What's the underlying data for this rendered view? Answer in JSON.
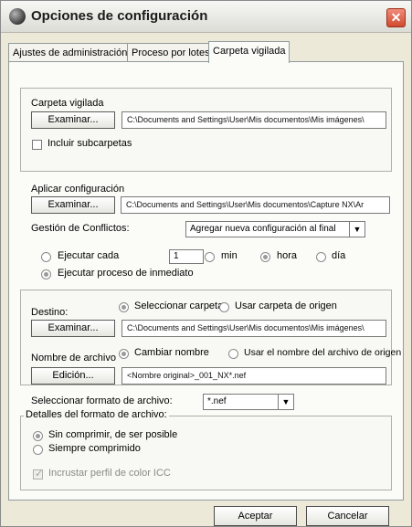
{
  "window": {
    "title": "Opciones de configuración"
  },
  "tabs": [
    "Ajustes de administración",
    "Proceso por lotes",
    "Carpeta vigilada"
  ],
  "watched": {
    "label": "Carpeta vigilada",
    "browse": "Examinar...",
    "path": "C:\\Documents and Settings\\User\\Mis documentos\\Mis imágenes\\",
    "subfolders": "Incluir subcarpetas"
  },
  "apply": {
    "label": "Aplicar configuración",
    "browse": "Examinar...",
    "path": "C:\\Documents and Settings\\User\\Mis documentos\\Capture NX\\Ar",
    "conflicts_label": "Gestión de Conflictos:",
    "conflicts_value": "Agregar nueva configuración al final",
    "run_every": "Ejecutar cada",
    "interval": "1",
    "unit_min": "min",
    "unit_hour": "hora",
    "unit_day": "día",
    "run_now": "Ejecutar proceso de inmediato"
  },
  "destination": {
    "label": "Destino:",
    "select_folder": "Seleccionar carpeta",
    "use_source": "Usar carpeta de origen",
    "browse": "Examinar...",
    "path": "C:\\Documents and Settings\\User\\Mis documentos\\Mis imágenes\\",
    "filename_label": "Nombre de archivo",
    "rename": "Cambiar nombre",
    "use_source_name": "Usar el nombre del archivo de origen",
    "edit": "Edición...",
    "pattern": "<Nombre original>_001_NX*.nef"
  },
  "format": {
    "label": "Seleccionar formato de archivo:",
    "value": "*.nef",
    "details_legend": "Detalles del formato de archivo:",
    "uncompressed": "Sin comprimir, de ser posible",
    "compressed": "Siempre comprimido",
    "embed_icc": "Incrustar perfil de color ICC"
  },
  "footer": {
    "ok": "Aceptar",
    "cancel": "Cancelar"
  },
  "icons": {
    "app": "app-orb-icon",
    "close": "close-icon",
    "dropdown": "chevron-down-icon",
    "check": "checkmark-icon"
  },
  "colors": {
    "panel": "#fbfbf8",
    "window": "#ece9d8",
    "close": "#d04a2f"
  }
}
